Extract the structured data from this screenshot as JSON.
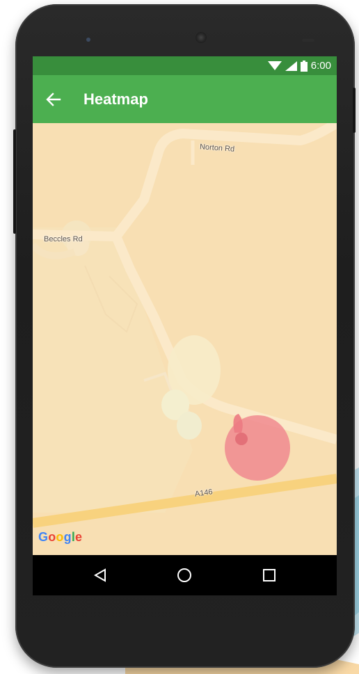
{
  "status_bar": {
    "time": "6:00"
  },
  "app_bar": {
    "title": "Heatmap"
  },
  "map": {
    "road_labels": [
      "Norton Rd",
      "Beccles Rd",
      "A146"
    ],
    "attribution": [
      "G",
      "o",
      "o",
      "g",
      "l",
      "e"
    ],
    "attribution_colors": [
      "#4285f4",
      "#ea4335",
      "#fbbc05",
      "#4285f4",
      "#34a853",
      "#ea4335"
    ],
    "heatmap_color": "#f08a8f"
  },
  "icons": {
    "status": [
      "wifi-icon",
      "signal-icon",
      "battery-icon"
    ],
    "nav": [
      "back-triangle-icon",
      "home-circle-icon",
      "recents-square-icon"
    ]
  },
  "colors": {
    "status_bar": "#388e3c",
    "app_bar": "#4caf50",
    "map_land": "#f8dfb3"
  }
}
